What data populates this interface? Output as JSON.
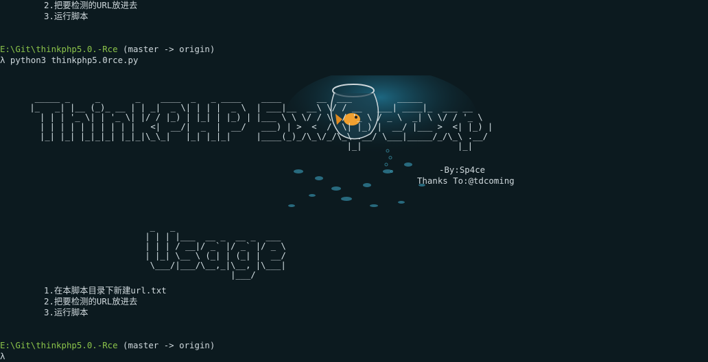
{
  "top": {
    "step2": "2.把要检测的URL放进去",
    "step3": "3.运行脚本"
  },
  "prompt1": {
    "path": "E:\\Git\\thinkphp5.0.-Rce",
    "branch": "(master -> origin)",
    "cmd": "λ python3 thinkphp5.0rce.py"
  },
  "banner": {
    "thinkphp": "  _____ _     _       _    ____  _   _ ____    ____       __  ___         _____\n |_   _| |__ (_)_ __ | | _|  _ \\| | | |  _ \\  | ___|__  __\\ \\/ / __   ___| ____|_  ___ __\n   | | | '_ \\| | '_ \\| |/ / |_) | |_| | |_) | |___ \\ \\ \\/ / \\  / '_ \\ / _ \\  _| \\ \\/ / '_ \\\n   | | | | | | | | | |   <|  __/|  _  |  __/   ___) | >  <  /  \\| |_) |  __/ |___ >  <| |_) |\n   |_| |_| |_|_|_| |_|_|\\_\\_|   |_| |_|_|     |____(_)_/\\_\\/_/\\_\\ .__/ \\___|_____/_/\\_\\ .__/\n                                                                |_|                   |_|",
    "by": "-By:Sp4ce",
    "thanks": "Thanks To:@tdcoming"
  },
  "usage": {
    "art": "  _   _\n | | | |___  __ _  __ _  ___\n | | | / __|/ _` |/ _` |/ _ \\\n | |_| \\__ \\ (_| | (_| |  __/\n  \\___/|___/\\__,_|\\__, |\\___|\n                  |___/",
    "step1": "1.在本脚本目录下新建url.txt",
    "step2": "2.把要检测的URL放进去",
    "step3": "3.运行脚本"
  },
  "prompt2": {
    "path": "E:\\Git\\thinkphp5.0.-Rce",
    "branch": "(master -> origin)",
    "cursor": "λ"
  }
}
